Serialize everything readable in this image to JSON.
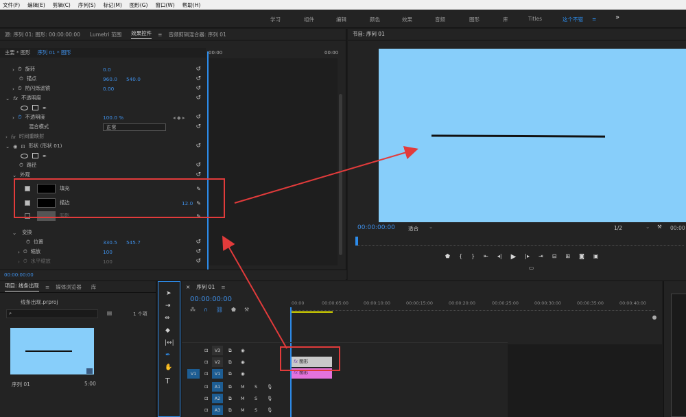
{
  "menu": [
    "文件(F)",
    "编辑(E)",
    "剪辑(C)",
    "序列(S)",
    "标记(M)",
    "图形(G)",
    "窗口(W)",
    "帮助(H)"
  ],
  "workspaces": [
    "学习",
    "组件",
    "编辑",
    "颜色",
    "效果",
    "音频",
    "图形",
    "库",
    "Titles",
    "这个不错"
  ],
  "ws_more": "»",
  "ws_menu": "≡",
  "ec_tabs": {
    "source": "源: 序列 01: 图形: 00:00:00:00",
    "lumetri": "Lumetri 范围",
    "effect": "效果控件",
    "audio": "音频剪辑混合器: 序列 01"
  },
  "ec_sub": {
    "main": "主要 * 图形",
    "seq": "序列 01 * 图形",
    "time0": "00:00",
    "time1": "00:00"
  },
  "props": {
    "rotation": {
      "label": "旋转",
      "value": "0.0"
    },
    "anchor": {
      "label": "锚点",
      "x": "960.0",
      "y": "540.0"
    },
    "flicker": {
      "label": "防闪烁滤镜",
      "value": "0.00"
    },
    "opacity_group": "不透明度",
    "opacity": {
      "label": "不透明度",
      "value": "100.0 %"
    },
    "blend": {
      "label": "混合模式",
      "value": "正常"
    },
    "time_remap": "时间重映射",
    "shape": "形状 (形状 01)",
    "path": "路径",
    "appearance": "外观",
    "fill": "填充",
    "stroke": {
      "label": "描边",
      "value": "12.0"
    },
    "shadow": "阴影",
    "transform": "变换",
    "position": {
      "label": "位置",
      "x": "330.5",
      "y": "545.7"
    },
    "scale": {
      "label": "缩放",
      "value": "100"
    },
    "hscale": {
      "label": "水平缩放",
      "value": "100"
    }
  },
  "ec_footer_time": "00:00:00:00",
  "program": {
    "title": "节目: 序列 01",
    "timecode": "00:00:00:00",
    "fit": "适合",
    "ratio": "1/2",
    "end": "00:00"
  },
  "project": {
    "tabs": [
      "项目: 线条出现",
      "媒体浏览器",
      "库"
    ],
    "file": "线条出现.prproj",
    "count": "1 个项",
    "seq_name": "序列 01",
    "seq_dur": "5:00"
  },
  "timeline": {
    "title": "序列 01",
    "timecode": "00:00:00:00",
    "ruler": [
      "00:00",
      "00:00:05:00",
      "00:00:10:00",
      "00:00:15:00",
      "00:00:20:00",
      "00:00:25:00",
      "00:00:30:00",
      "00:00:35:00",
      "00:00:40:00"
    ],
    "tracks": [
      "V3",
      "V2",
      "V1",
      "A1",
      "A2",
      "A3"
    ],
    "src_v": "V1",
    "src_a": "A1",
    "m": "M",
    "s": "S",
    "clip_label": "图形",
    "fx": "fx"
  },
  "icons": {
    "reset": "↺",
    "eye": "●",
    "lock": "🔒",
    "pen": "✒",
    "hand": "✋",
    "text": "T",
    "select": "▶",
    "wrench": "🔧",
    "play": "▶",
    "dropper": "⁄"
  },
  "colors": {
    "accent": "#2d8ceb",
    "value": "#3e8ee6",
    "screen": "#87cefa",
    "arrow": "#e23b3b",
    "clip_v2": "#c9c9c9",
    "clip_v1": "#e472dc"
  }
}
